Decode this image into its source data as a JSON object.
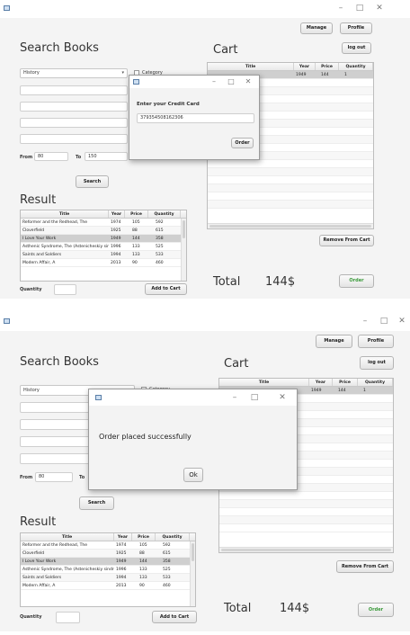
{
  "window": {
    "minimize": "–",
    "maximize": "□",
    "close": "✕"
  },
  "header": {
    "manage_label": "Manage",
    "profile_label": "Profile",
    "logout_label": "log out"
  },
  "search": {
    "title": "Search Books",
    "category_value": "History",
    "category_label": "Category",
    "from_label": "From",
    "from_value": "80",
    "to_label": "To",
    "to_value": "150",
    "search_label": "Search"
  },
  "result": {
    "title": "Result",
    "columns": [
      "Title",
      "Year",
      "Price",
      "Quantity"
    ],
    "rows": [
      [
        "Reformer and the Redhead, The",
        "1974",
        "105",
        "592"
      ],
      [
        "Cloverfield",
        "1925",
        "88",
        "615"
      ],
      [
        "I Love Your Work",
        "1949",
        "144",
        "358"
      ],
      [
        "Asthenic Syndrome, The (Astenicheskiy sindrom)",
        "1996",
        "133",
        "525"
      ],
      [
        "Saints and Soldiers",
        "1994",
        "133",
        "533"
      ],
      [
        "Modern Affair, A",
        "2013",
        "90",
        "460"
      ]
    ],
    "selected_row_index": 2,
    "quantity_label": "Quantity",
    "add_to_cart_label": "Add to Cart"
  },
  "cart": {
    "title": "Cart",
    "columns": [
      "Title",
      "Year",
      "Price",
      "Quantity"
    ],
    "rows": [
      [
        "",
        "1949",
        "144",
        "1"
      ]
    ],
    "remove_label": "Remove From Cart",
    "total_label": "Total",
    "total_value": "144$",
    "order_label": "Order"
  },
  "credit_dialog": {
    "prompt": "Enter your Credit Card",
    "card_value": "379354508162306",
    "order_label": "Order"
  },
  "success_dialog": {
    "message": "Order placed successfully",
    "ok_label": "Ok"
  },
  "colors": {
    "order_text": "#3a9a3a",
    "selected_row": "#cfcfcf"
  }
}
